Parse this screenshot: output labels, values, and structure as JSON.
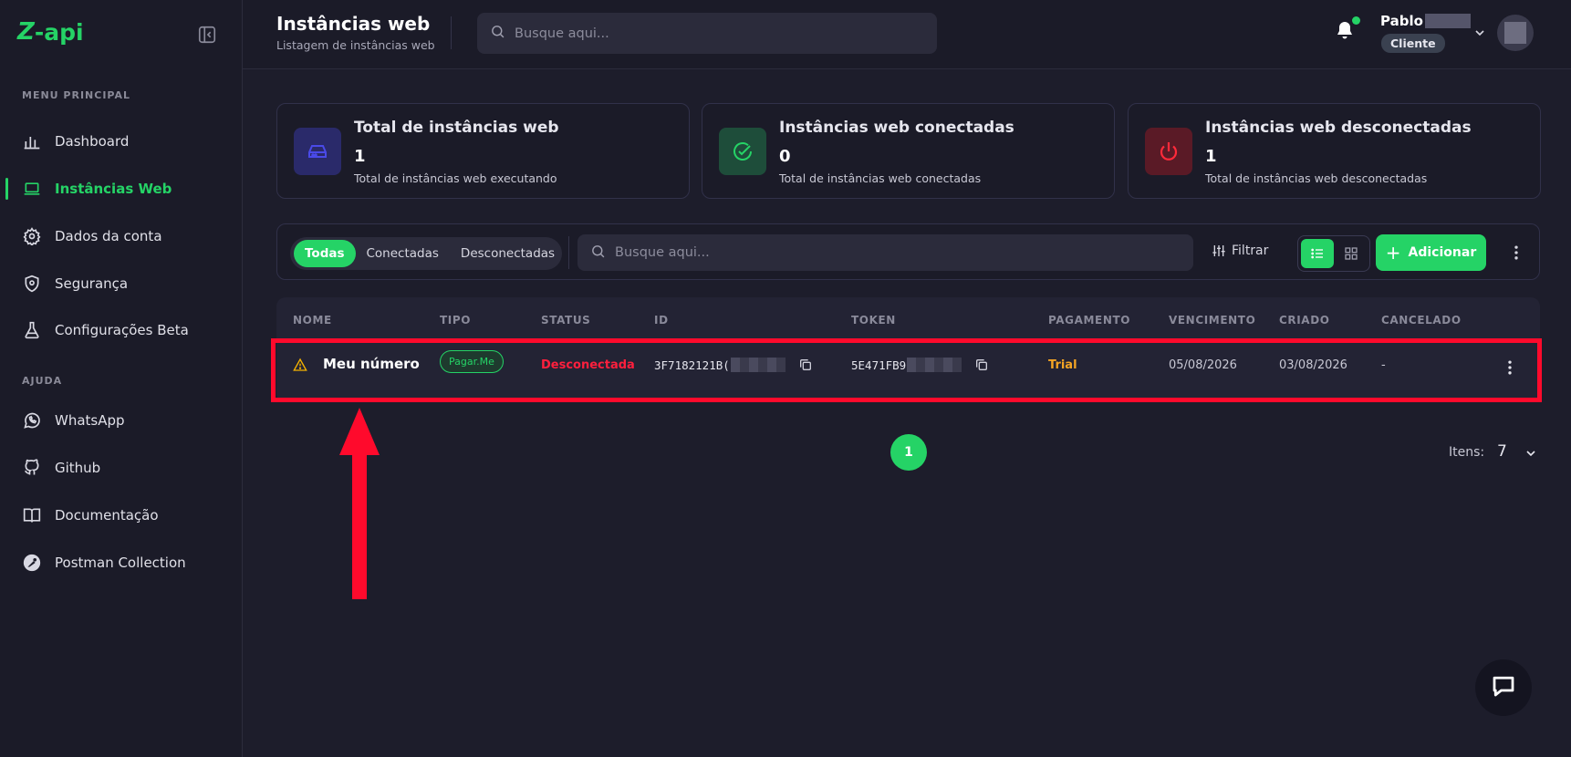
{
  "brand": {
    "logo_z": "Z",
    "logo_text": "-api",
    "accent": "#25d366"
  },
  "sidebar": {
    "main_section": "MENU PRINCIPAL",
    "help_section": "AJUDA",
    "items": [
      {
        "label": "Dashboard",
        "icon": "bar-chart-icon"
      },
      {
        "label": "Instâncias Web",
        "icon": "laptop-icon",
        "active": true
      },
      {
        "label": "Dados da conta",
        "icon": "gear-icon"
      },
      {
        "label": "Segurança",
        "icon": "shield-icon"
      },
      {
        "label": "Configurações Beta",
        "icon": "flask-icon"
      }
    ],
    "help_items": [
      {
        "label": "WhatsApp",
        "icon": "whatsapp-icon"
      },
      {
        "label": "Github",
        "icon": "github-icon"
      },
      {
        "label": "Documentação",
        "icon": "book-icon"
      },
      {
        "label": "Postman Collection",
        "icon": "postman-icon"
      }
    ]
  },
  "header": {
    "title": "Instâncias web",
    "subtitle": "Listagem de instâncias web",
    "search_placeholder": "Busque aqui...",
    "user_name": "Pablo",
    "user_role": "Cliente"
  },
  "stats": [
    {
      "title": "Total de instâncias web",
      "value": "1",
      "desc": "Total de instâncias web executando",
      "color": "#3b3bd6"
    },
    {
      "title": "Instâncias web conectadas",
      "value": "0",
      "desc": "Total de instâncias web conectadas",
      "color": "#25d366"
    },
    {
      "title": "Instâncias web desconectadas",
      "value": "1",
      "desc": "Total de instâncias web desconectadas",
      "color": "#ff2a3a"
    }
  ],
  "toolbar": {
    "tabs": [
      "Todas",
      "Conectadas",
      "Desconectadas"
    ],
    "search_placeholder": "Busque aqui...",
    "filter_label": "Filtrar",
    "add_label": "Adicionar"
  },
  "table": {
    "columns": [
      "NOME",
      "TIPO",
      "STATUS",
      "ID",
      "TOKEN",
      "PAGAMENTO",
      "VENCIMENTO",
      "CRIADO",
      "CANCELADO"
    ],
    "rows": [
      {
        "name": "Meu número",
        "type": "Pagar.Me",
        "status": "Desconectada",
        "id": "3F7182121B(",
        "token": "5E471FB9",
        "payment": "Trial",
        "due": "05/08/2026",
        "created": "03/08/2026",
        "cancelled": "-"
      }
    ]
  },
  "pagination": {
    "page": "1",
    "items_label": "Itens:",
    "items_value": "7"
  }
}
